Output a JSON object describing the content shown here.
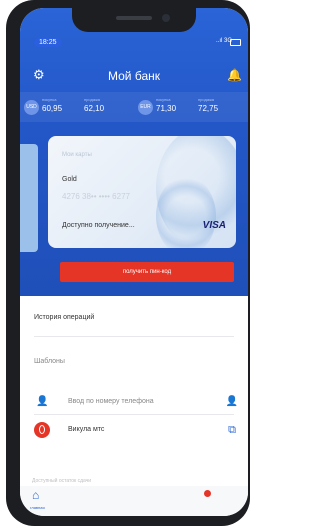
{
  "status": {
    "time": "18:25",
    "network": "..ıl 3G"
  },
  "header": {
    "title": "Мой банк"
  },
  "rates": [
    {
      "code": "USD",
      "label": "покупка",
      "value": "60,95",
      "label2": "продажа",
      "value2": "62,10"
    },
    {
      "code": "EUR",
      "label": "покупка",
      "value": "71,30",
      "label2": "продажа",
      "value2": "72,75"
    }
  ],
  "card": {
    "top": "Мои карты",
    "name": "Gold",
    "number": "4276 38•• •••• 6277",
    "available": "Доступно получение...",
    "brand": "VISA"
  },
  "pin_button": "получить пин-код",
  "history": "История операций",
  "templates": "Шаблоны",
  "template_items": [
    {
      "label": "Ввод по номеру телефона"
    },
    {
      "label": "Викула мтс"
    }
  ],
  "faded_text": "Доступный остаток сдачи",
  "tabbar": {
    "home_label": "главная"
  },
  "icons": {
    "settings": "gear-icon",
    "notifications": "bell-icon",
    "person": "person-icon",
    "cards": "cards-icon",
    "home": "home-icon"
  },
  "colors": {
    "primary": "#2357c8",
    "accent_red": "#e53527",
    "card_brand": "#1a1f71"
  }
}
